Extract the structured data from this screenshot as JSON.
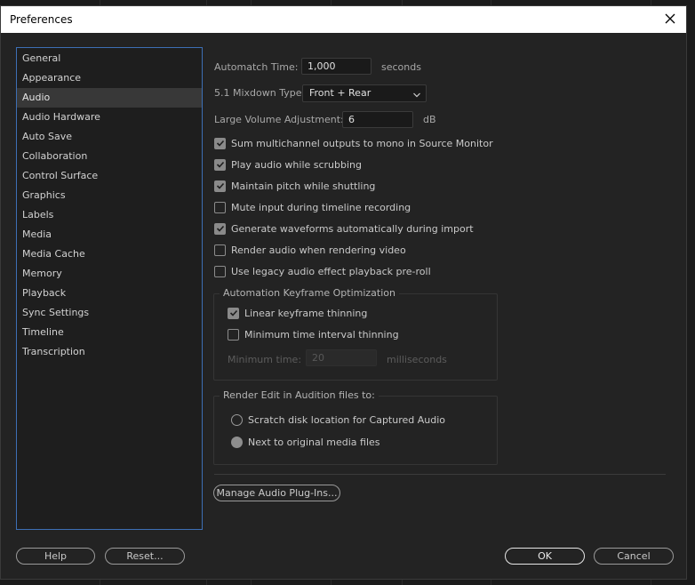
{
  "window": {
    "title": "Preferences"
  },
  "sidebar": {
    "items": [
      {
        "label": "General"
      },
      {
        "label": "Appearance"
      },
      {
        "label": "Audio",
        "selected": true
      },
      {
        "label": "Audio Hardware"
      },
      {
        "label": "Auto Save"
      },
      {
        "label": "Collaboration"
      },
      {
        "label": "Control Surface"
      },
      {
        "label": "Graphics"
      },
      {
        "label": "Labels"
      },
      {
        "label": "Media"
      },
      {
        "label": "Media Cache"
      },
      {
        "label": "Memory"
      },
      {
        "label": "Playback"
      },
      {
        "label": "Sync Settings"
      },
      {
        "label": "Timeline"
      },
      {
        "label": "Transcription"
      }
    ]
  },
  "audio": {
    "automatch": {
      "label": "Automatch Time:",
      "value": "1,000",
      "unit": "seconds"
    },
    "mixdown": {
      "label": "5.1 Mixdown Type:",
      "value": "Front + Rear"
    },
    "volume": {
      "label": "Large Volume Adjustment:",
      "value": "6",
      "unit": "dB"
    },
    "options": [
      {
        "label": "Sum multichannel outputs to mono in Source Monitor",
        "checked": true
      },
      {
        "label": "Play audio while scrubbing",
        "checked": true
      },
      {
        "label": "Maintain pitch while shuttling",
        "checked": true
      },
      {
        "label": "Mute input during timeline recording",
        "checked": false
      },
      {
        "label": "Generate waveforms automatically during import",
        "checked": true
      },
      {
        "label": "Render audio when rendering video",
        "checked": false
      },
      {
        "label": "Use legacy audio effect playback pre-roll",
        "checked": false
      }
    ],
    "keyframe_group": {
      "title": "Automation Keyframe Optimization",
      "linear": {
        "label": "Linear keyframe thinning",
        "checked": true
      },
      "min_interval": {
        "label": "Minimum time interval thinning",
        "checked": false
      },
      "min_time": {
        "label": "Minimum time:",
        "value": "20",
        "unit": "milliseconds"
      }
    },
    "render_group": {
      "title": "Render Edit in Audition files to:",
      "scratch": {
        "label": "Scratch disk location for Captured Audio",
        "selected": false
      },
      "next_to": {
        "label": "Next to original media files",
        "selected": true
      }
    },
    "manage_button": "Manage Audio Plug-Ins..."
  },
  "footer": {
    "help": "Help",
    "reset": "Reset...",
    "ok": "OK",
    "cancel": "Cancel"
  }
}
